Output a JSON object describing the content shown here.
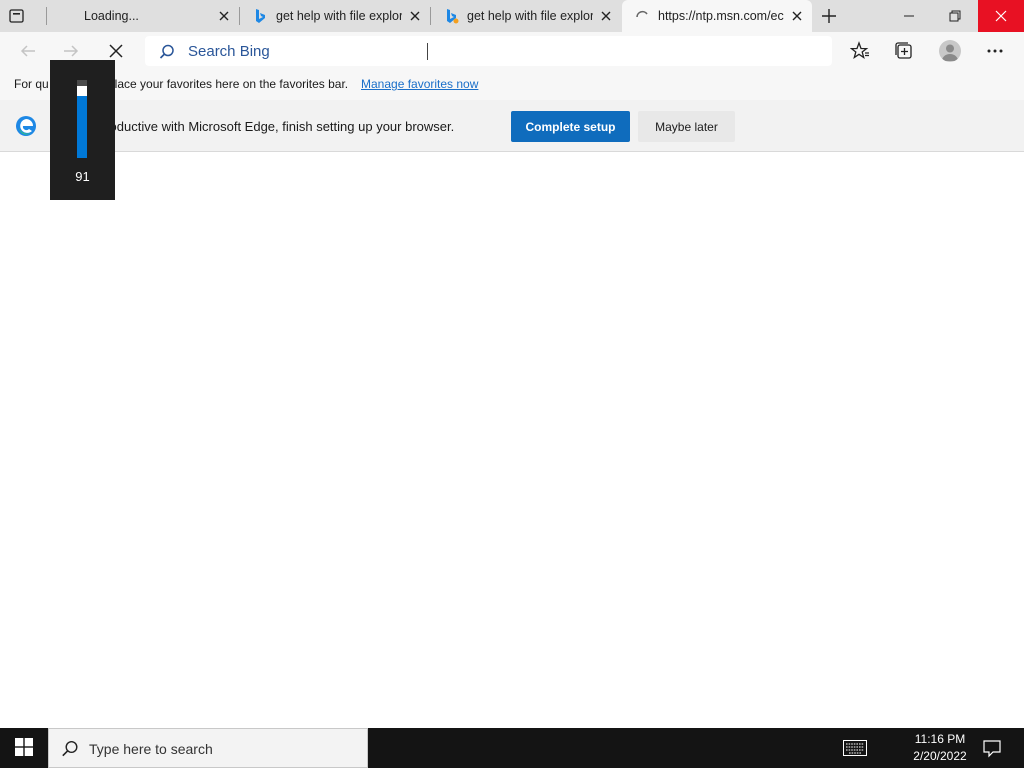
{
  "tabs": [
    {
      "title": "Loading...",
      "icon": "loading-icon",
      "active": false
    },
    {
      "title": "get help with file explor",
      "icon": "bing-icon",
      "active": false
    },
    {
      "title": "get help with file explor",
      "icon": "bing-icon",
      "active": false
    },
    {
      "title": "https://ntp.msn.com/ec",
      "icon": "spinner-icon",
      "active": true
    }
  ],
  "address_bar": {
    "placeholder": "Search Bing"
  },
  "favorites_bar": {
    "text_before": "For qu",
    "text_after": "place your favorites here on the favorites bar.",
    "link": "Manage favorites now"
  },
  "setup_banner": {
    "message": "productive with Microsoft Edge, finish setting up your browser.",
    "primary_button": "Complete setup",
    "secondary_button": "Maybe later"
  },
  "volume_flyout": {
    "value": 91,
    "level_fraction": 0.91
  },
  "taskbar": {
    "search_placeholder": "Type here to search",
    "time": "11:16 PM",
    "date": "2/20/2022"
  },
  "colors": {
    "accent": "#0f6cbd",
    "close_button": "#e81123",
    "link": "#1a6fc9",
    "taskbar": "#141414"
  }
}
